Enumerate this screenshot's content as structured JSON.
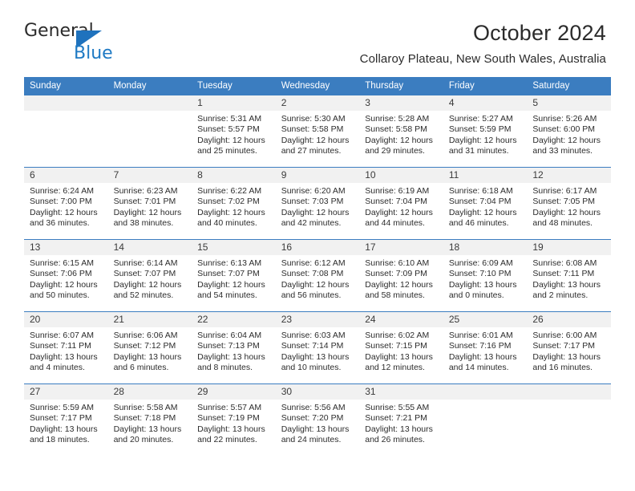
{
  "brand": {
    "name_top": "General",
    "name_bottom": "Blue",
    "triangle_color": "#1f72bd",
    "blue_text_color": "#1f7ac4"
  },
  "header": {
    "title": "October 2024",
    "subtitle": "Collaroy Plateau, New South Wales, Australia",
    "header_bg_color": "#3b7dc0",
    "date_strip_color": "#f1f1f1"
  },
  "weekday_headers": [
    "Sunday",
    "Monday",
    "Tuesday",
    "Wednesday",
    "Thursday",
    "Friday",
    "Saturday"
  ],
  "weeks": [
    [
      {
        "date": "",
        "empty": true,
        "sunrise": "",
        "sunset": "",
        "daylight_1": "",
        "daylight_2": ""
      },
      {
        "date": "",
        "empty": true,
        "sunrise": "",
        "sunset": "",
        "daylight_1": "",
        "daylight_2": ""
      },
      {
        "date": "1",
        "sunrise": "Sunrise: 5:31 AM",
        "sunset": "Sunset: 5:57 PM",
        "daylight_1": "Daylight: 12 hours",
        "daylight_2": "and 25 minutes."
      },
      {
        "date": "2",
        "sunrise": "Sunrise: 5:30 AM",
        "sunset": "Sunset: 5:58 PM",
        "daylight_1": "Daylight: 12 hours",
        "daylight_2": "and 27 minutes."
      },
      {
        "date": "3",
        "sunrise": "Sunrise: 5:28 AM",
        "sunset": "Sunset: 5:58 PM",
        "daylight_1": "Daylight: 12 hours",
        "daylight_2": "and 29 minutes."
      },
      {
        "date": "4",
        "sunrise": "Sunrise: 5:27 AM",
        "sunset": "Sunset: 5:59 PM",
        "daylight_1": "Daylight: 12 hours",
        "daylight_2": "and 31 minutes."
      },
      {
        "date": "5",
        "sunrise": "Sunrise: 5:26 AM",
        "sunset": "Sunset: 6:00 PM",
        "daylight_1": "Daylight: 12 hours",
        "daylight_2": "and 33 minutes."
      }
    ],
    [
      {
        "date": "6",
        "sunrise": "Sunrise: 6:24 AM",
        "sunset": "Sunset: 7:00 PM",
        "daylight_1": "Daylight: 12 hours",
        "daylight_2": "and 36 minutes."
      },
      {
        "date": "7",
        "sunrise": "Sunrise: 6:23 AM",
        "sunset": "Sunset: 7:01 PM",
        "daylight_1": "Daylight: 12 hours",
        "daylight_2": "and 38 minutes."
      },
      {
        "date": "8",
        "sunrise": "Sunrise: 6:22 AM",
        "sunset": "Sunset: 7:02 PM",
        "daylight_1": "Daylight: 12 hours",
        "daylight_2": "and 40 minutes."
      },
      {
        "date": "9",
        "sunrise": "Sunrise: 6:20 AM",
        "sunset": "Sunset: 7:03 PM",
        "daylight_1": "Daylight: 12 hours",
        "daylight_2": "and 42 minutes."
      },
      {
        "date": "10",
        "sunrise": "Sunrise: 6:19 AM",
        "sunset": "Sunset: 7:04 PM",
        "daylight_1": "Daylight: 12 hours",
        "daylight_2": "and 44 minutes."
      },
      {
        "date": "11",
        "sunrise": "Sunrise: 6:18 AM",
        "sunset": "Sunset: 7:04 PM",
        "daylight_1": "Daylight: 12 hours",
        "daylight_2": "and 46 minutes."
      },
      {
        "date": "12",
        "sunrise": "Sunrise: 6:17 AM",
        "sunset": "Sunset: 7:05 PM",
        "daylight_1": "Daylight: 12 hours",
        "daylight_2": "and 48 minutes."
      }
    ],
    [
      {
        "date": "13",
        "sunrise": "Sunrise: 6:15 AM",
        "sunset": "Sunset: 7:06 PM",
        "daylight_1": "Daylight: 12 hours",
        "daylight_2": "and 50 minutes."
      },
      {
        "date": "14",
        "sunrise": "Sunrise: 6:14 AM",
        "sunset": "Sunset: 7:07 PM",
        "daylight_1": "Daylight: 12 hours",
        "daylight_2": "and 52 minutes."
      },
      {
        "date": "15",
        "sunrise": "Sunrise: 6:13 AM",
        "sunset": "Sunset: 7:07 PM",
        "daylight_1": "Daylight: 12 hours",
        "daylight_2": "and 54 minutes."
      },
      {
        "date": "16",
        "sunrise": "Sunrise: 6:12 AM",
        "sunset": "Sunset: 7:08 PM",
        "daylight_1": "Daylight: 12 hours",
        "daylight_2": "and 56 minutes."
      },
      {
        "date": "17",
        "sunrise": "Sunrise: 6:10 AM",
        "sunset": "Sunset: 7:09 PM",
        "daylight_1": "Daylight: 12 hours",
        "daylight_2": "and 58 minutes."
      },
      {
        "date": "18",
        "sunrise": "Sunrise: 6:09 AM",
        "sunset": "Sunset: 7:10 PM",
        "daylight_1": "Daylight: 13 hours",
        "daylight_2": "and 0 minutes."
      },
      {
        "date": "19",
        "sunrise": "Sunrise: 6:08 AM",
        "sunset": "Sunset: 7:11 PM",
        "daylight_1": "Daylight: 13 hours",
        "daylight_2": "and 2 minutes."
      }
    ],
    [
      {
        "date": "20",
        "sunrise": "Sunrise: 6:07 AM",
        "sunset": "Sunset: 7:11 PM",
        "daylight_1": "Daylight: 13 hours",
        "daylight_2": "and 4 minutes."
      },
      {
        "date": "21",
        "sunrise": "Sunrise: 6:06 AM",
        "sunset": "Sunset: 7:12 PM",
        "daylight_1": "Daylight: 13 hours",
        "daylight_2": "and 6 minutes."
      },
      {
        "date": "22",
        "sunrise": "Sunrise: 6:04 AM",
        "sunset": "Sunset: 7:13 PM",
        "daylight_1": "Daylight: 13 hours",
        "daylight_2": "and 8 minutes."
      },
      {
        "date": "23",
        "sunrise": "Sunrise: 6:03 AM",
        "sunset": "Sunset: 7:14 PM",
        "daylight_1": "Daylight: 13 hours",
        "daylight_2": "and 10 minutes."
      },
      {
        "date": "24",
        "sunrise": "Sunrise: 6:02 AM",
        "sunset": "Sunset: 7:15 PM",
        "daylight_1": "Daylight: 13 hours",
        "daylight_2": "and 12 minutes."
      },
      {
        "date": "25",
        "sunrise": "Sunrise: 6:01 AM",
        "sunset": "Sunset: 7:16 PM",
        "daylight_1": "Daylight: 13 hours",
        "daylight_2": "and 14 minutes."
      },
      {
        "date": "26",
        "sunrise": "Sunrise: 6:00 AM",
        "sunset": "Sunset: 7:17 PM",
        "daylight_1": "Daylight: 13 hours",
        "daylight_2": "and 16 minutes."
      }
    ],
    [
      {
        "date": "27",
        "sunrise": "Sunrise: 5:59 AM",
        "sunset": "Sunset: 7:17 PM",
        "daylight_1": "Daylight: 13 hours",
        "daylight_2": "and 18 minutes."
      },
      {
        "date": "28",
        "sunrise": "Sunrise: 5:58 AM",
        "sunset": "Sunset: 7:18 PM",
        "daylight_1": "Daylight: 13 hours",
        "daylight_2": "and 20 minutes."
      },
      {
        "date": "29",
        "sunrise": "Sunrise: 5:57 AM",
        "sunset": "Sunset: 7:19 PM",
        "daylight_1": "Daylight: 13 hours",
        "daylight_2": "and 22 minutes."
      },
      {
        "date": "30",
        "sunrise": "Sunrise: 5:56 AM",
        "sunset": "Sunset: 7:20 PM",
        "daylight_1": "Daylight: 13 hours",
        "daylight_2": "and 24 minutes."
      },
      {
        "date": "31",
        "sunrise": "Sunrise: 5:55 AM",
        "sunset": "Sunset: 7:21 PM",
        "daylight_1": "Daylight: 13 hours",
        "daylight_2": "and 26 minutes."
      },
      {
        "date": "",
        "empty": true,
        "sunrise": "",
        "sunset": "",
        "daylight_1": "",
        "daylight_2": ""
      },
      {
        "date": "",
        "empty": true,
        "sunrise": "",
        "sunset": "",
        "daylight_1": "",
        "daylight_2": ""
      }
    ]
  ]
}
